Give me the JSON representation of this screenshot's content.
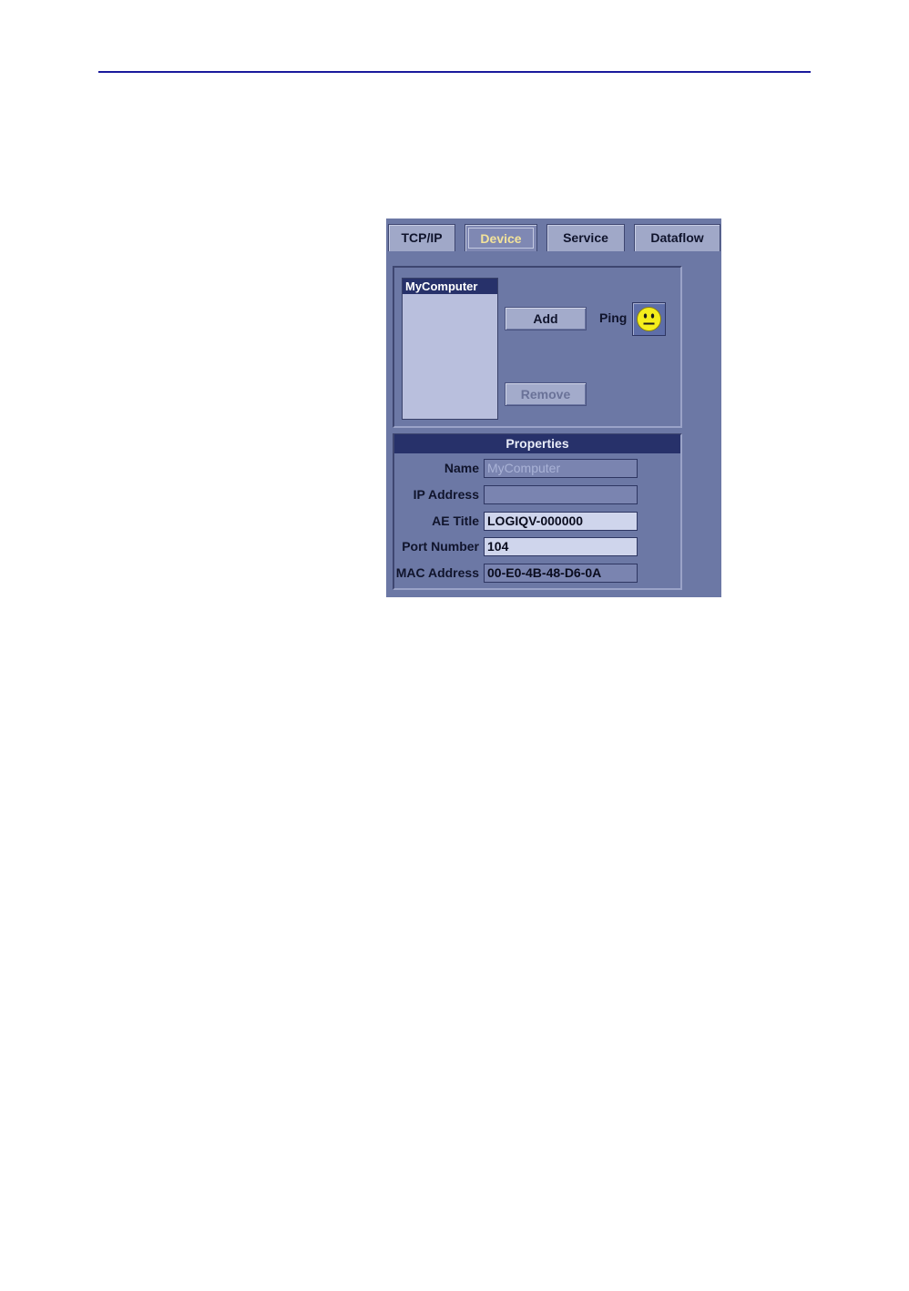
{
  "tabs": [
    {
      "label": "TCP/IP",
      "active": false
    },
    {
      "label": "Device",
      "active": true
    },
    {
      "label": "Service",
      "active": false
    },
    {
      "label": "Dataflow",
      "active": false
    }
  ],
  "devices": {
    "items": [
      "MyComputer"
    ],
    "add_label": "Add",
    "remove_label": "Remove",
    "ping_label": "Ping",
    "ping_status_icon": "neutral-face-icon"
  },
  "properties": {
    "title": "Properties",
    "name_label": "Name",
    "name_value": "MyComputer",
    "ip_label": "IP Address",
    "ip_value": "",
    "ae_label": "AE Title",
    "ae_value": "LOGIQV-000000",
    "port_label": "Port Number",
    "port_value": "104",
    "mac_label": "MAC Address",
    "mac_value": "00-E0-4B-48-D6-0A"
  },
  "colors": {
    "panel_bg": "#6c78a5",
    "header_bg": "#27316a",
    "active_tab_text": "#f3e39a",
    "rule": "#1a1a9c",
    "smiley": "#f5ee1c"
  }
}
